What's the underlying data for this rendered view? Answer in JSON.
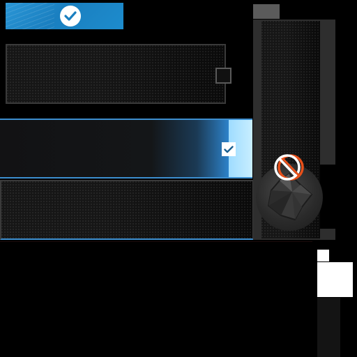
{
  "colors": {
    "accent_blue": "#1d8ccd",
    "highlight_cyan": "#9fdcff",
    "border_gray": "#3a3a3a",
    "danger_orange": "#e8501a",
    "background": "#000000"
  },
  "icons": {
    "confirm": "checkmark-circle-icon",
    "row_select": "checkbox-checked-icon",
    "panel_toggle": "checkbox-empty-icon",
    "blocked": "no-entry-icon",
    "knob": "polyhedron-knob-icon"
  },
  "state": {
    "row_1_selected": true,
    "row_2_selected": false,
    "panel_checked": false
  }
}
